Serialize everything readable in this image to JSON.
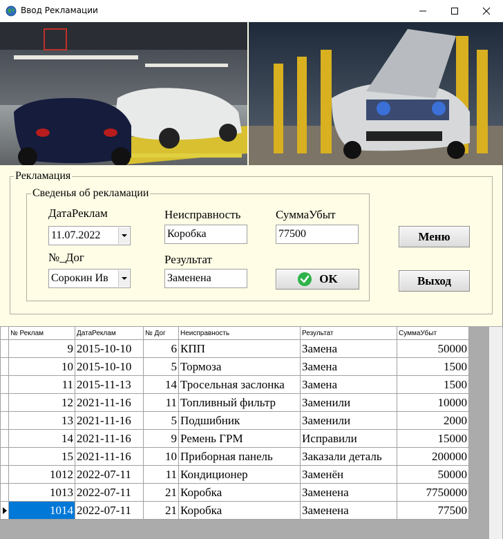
{
  "window": {
    "title": "Ввод Рекламации"
  },
  "groups": {
    "outer": "Рекламация",
    "inner": "Сведенья об рекламации"
  },
  "form": {
    "date_label": "ДатаРеклам",
    "date_value": "11.07.2022",
    "contract_label": "№_Дог",
    "contract_value": "Сорокин Ив",
    "fault_label": "Неисправность",
    "fault_value": "Коробка",
    "result_label": "Результат",
    "result_value": "Заменена",
    "damage_label": "СуммаУбыт",
    "damage_value": "77500",
    "ok_label": "OK"
  },
  "buttons": {
    "menu": "Меню",
    "exit": "Выход"
  },
  "table": {
    "columns": [
      "№ Реклам",
      "ДатаРеклам",
      "№ Дог",
      "Неисправность",
      "Результат",
      "СуммаУбыт"
    ],
    "rows": [
      [
        "9",
        "2015-10-10",
        "6",
        "КПП",
        "Замена",
        "50000"
      ],
      [
        "10",
        "2015-10-10",
        "5",
        "Тормоза",
        "Замена",
        "1500"
      ],
      [
        "11",
        "2015-11-13",
        "14",
        "Тросельная заслонка",
        "Замена",
        "1500"
      ],
      [
        "12",
        "2021-11-16",
        "11",
        "Топливный фильтр",
        "Заменили",
        "10000"
      ],
      [
        "13",
        "2021-11-16",
        "5",
        "Подшибник",
        "Заменили",
        "2000"
      ],
      [
        "14",
        "2021-11-16",
        "9",
        "Ремень ГРМ",
        "Исправили",
        "15000"
      ],
      [
        "15",
        "2021-11-16",
        "10",
        "Приборная панель",
        "Заказали деталь",
        "200000"
      ],
      [
        "1012",
        "2022-07-11",
        "11",
        "Кондиционер",
        "Заменён",
        "50000"
      ],
      [
        "1013",
        "2022-07-11",
        "21",
        "Коробка",
        "Заменена",
        "7750000"
      ],
      [
        "1014",
        "2022-07-11",
        "21",
        "Коробка",
        "Заменена",
        "77500"
      ]
    ],
    "selected_row": 9
  },
  "colors": {
    "form_bg": "#fffde6",
    "selection": "#0078d7",
    "ok_icon": "#2db34a"
  },
  "icons": {
    "app": "globe-icon",
    "ok": "check-circle-icon"
  }
}
